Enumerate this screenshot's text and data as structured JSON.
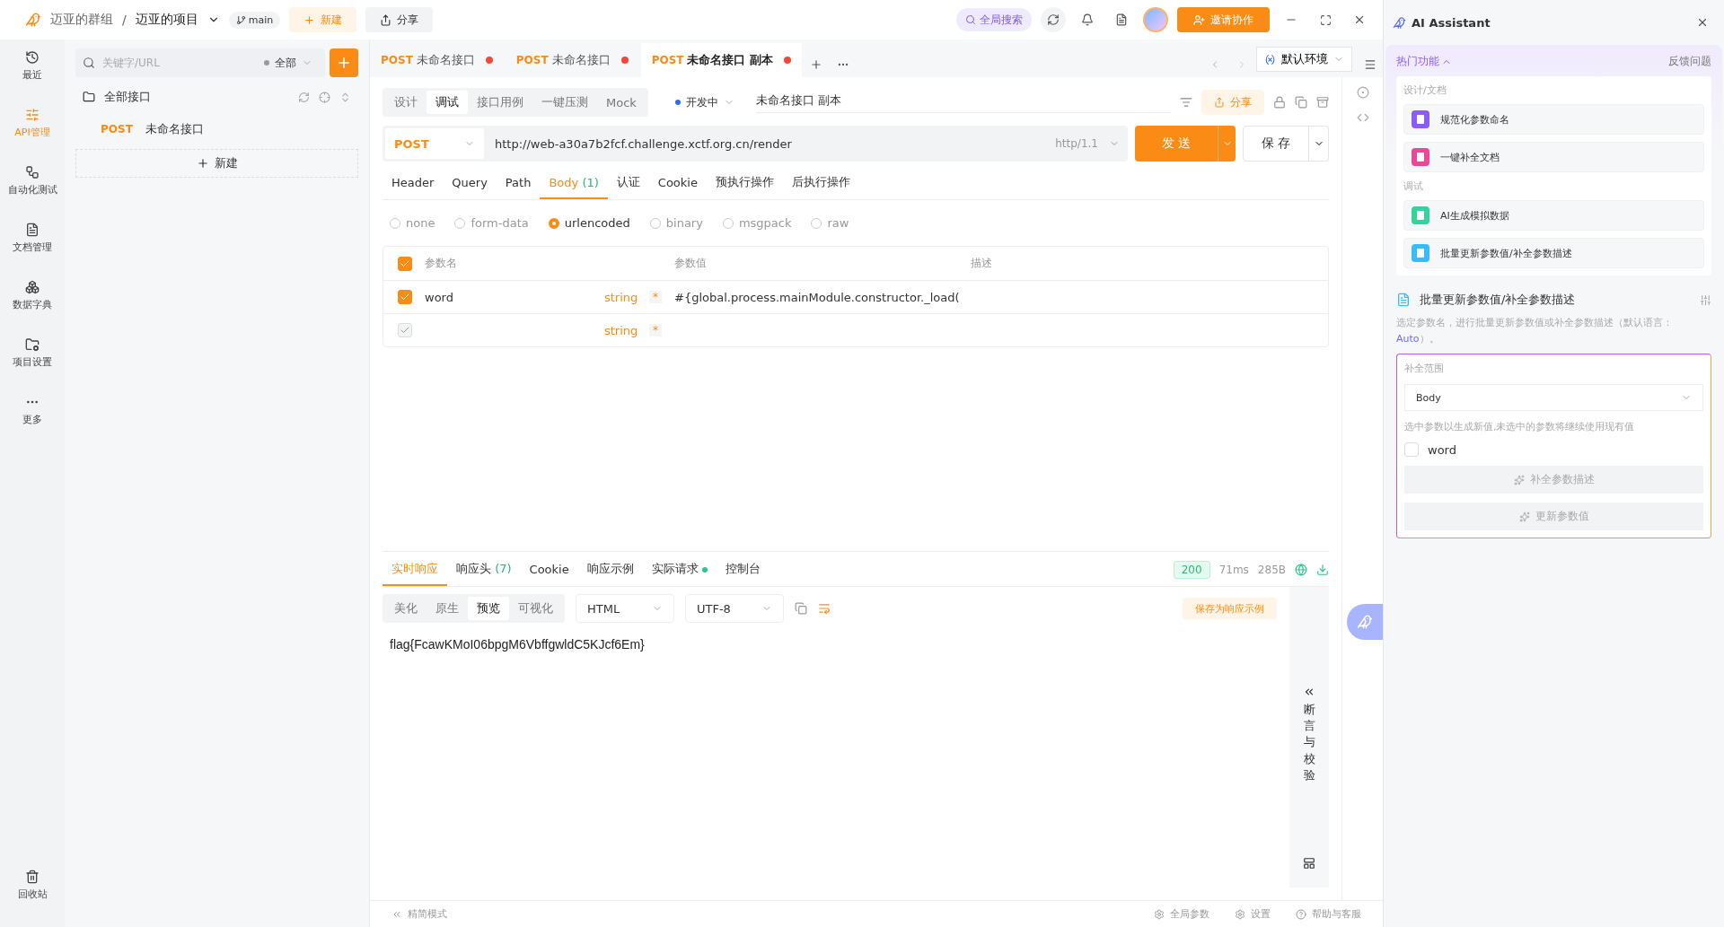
{
  "breadcrumb": {
    "team": "迈亚的群组",
    "separator": "/",
    "project": "迈亚的项目",
    "branch": "main"
  },
  "top_actions": [
    {
      "label": "新建",
      "kind": "new"
    },
    {
      "label": "分享",
      "kind": "share"
    }
  ],
  "global_search": "全局搜索",
  "invite": "邀请协作",
  "nav": [
    {
      "label": "最近",
      "selected": false
    },
    {
      "label": "API管理",
      "selected": true
    },
    {
      "label": "自动化测试",
      "selected": false
    },
    {
      "label": "文档管理",
      "selected": false
    },
    {
      "label": "数据字典",
      "selected": false
    },
    {
      "label": "项目设置",
      "selected": false
    },
    {
      "label": "更多",
      "selected": false
    }
  ],
  "trash": "回收站",
  "tree": {
    "placeholder": "关键字/URL",
    "filter": "全部",
    "root": "全部接口",
    "items": [
      {
        "method": "POST",
        "name": "未命名接口"
      }
    ],
    "new_label": "新建"
  },
  "tabs": [
    {
      "method": "POST",
      "name": "未命名接口",
      "selected": false,
      "unsaved": true
    },
    {
      "method": "POST",
      "name": "未命名接口",
      "selected": false,
      "unsaved": true
    },
    {
      "method": "POST",
      "name": "未命名接口 副本",
      "selected": true,
      "unsaved": true
    }
  ],
  "environment": "默认环境",
  "mode_tabs": [
    {
      "label": "设计",
      "selected": false
    },
    {
      "label": "调试",
      "selected": true
    },
    {
      "label": "接口用例",
      "selected": false
    },
    {
      "label": "一键压测",
      "selected": false
    },
    {
      "label": "Mock",
      "selected": false
    }
  ],
  "status": "开发中",
  "api_name": "未命名接口 副本",
  "share": "分享",
  "request": {
    "method": "POST",
    "url": "http://web-a30a7b2fcf.challenge.xctf.org.cn/render",
    "protocol": "http/1.1",
    "send": "发 送",
    "save": "保 存"
  },
  "param_tabs": [
    {
      "label": "Header",
      "selected": false
    },
    {
      "label": "Query",
      "selected": false
    },
    {
      "label": "Path",
      "selected": false
    },
    {
      "label": "Body",
      "count": "(1)",
      "selected": true
    },
    {
      "label": "认证",
      "selected": false
    },
    {
      "label": "Cookie",
      "selected": false
    },
    {
      "label": "预执行操作",
      "selected": false
    },
    {
      "label": "后执行操作",
      "selected": false
    }
  ],
  "body_types": [
    {
      "label": "none",
      "selected": false
    },
    {
      "label": "form-data",
      "selected": false
    },
    {
      "label": "urlencoded",
      "selected": true
    },
    {
      "label": "binary",
      "selected": false
    },
    {
      "label": "msgpack",
      "selected": false
    },
    {
      "label": "raw",
      "selected": false
    }
  ],
  "params": {
    "columns": [
      "参数名",
      "参数值",
      "描述"
    ],
    "all_checked": true,
    "rows": [
      {
        "checked": true,
        "disabled": false,
        "name": "word",
        "type": "string",
        "required": "*",
        "value": "#{global.process.mainModule.constructor._load("
      },
      {
        "checked": true,
        "disabled": true,
        "type": "string",
        "required": "*"
      }
    ]
  },
  "response_tabs": [
    {
      "label": "实时响应",
      "selected": true
    },
    {
      "label": "响应头",
      "count": "(7)",
      "selected": false
    },
    {
      "label": "Cookie",
      "selected": false
    },
    {
      "label": "响应示例",
      "selected": false
    },
    {
      "label": "实际请求",
      "dot": true,
      "selected": false
    },
    {
      "label": "控制台",
      "selected": false
    }
  ],
  "response_meta": {
    "status": "200",
    "time": "71ms",
    "size": "285B"
  },
  "view_tabs": [
    {
      "label": "美化",
      "selected": false
    },
    {
      "label": "原生",
      "selected": false
    },
    {
      "label": "预览",
      "selected": true
    },
    {
      "label": "可视化",
      "selected": false
    }
  ],
  "format": "HTML",
  "encoding": "UTF-8",
  "save_example": "保存为响应示例",
  "response_body": "flag{FcawKMoI06bpgM6VbffgwldC5KJcf6Em}",
  "assertions": "断言与校验",
  "footer": {
    "simple_mode": "精简模式",
    "links": [
      "全局参数",
      "设置",
      "帮助与客服"
    ]
  },
  "ai": {
    "title": "AI Assistant",
    "hot": "热门功能",
    "feedback": "反馈问题",
    "groups": [
      {
        "title": "设计/文档",
        "items": [
          {
            "label": "规范化参数命名",
            "color": "#8b5cf6"
          },
          {
            "label": "一键补全文档",
            "color": "#ec4899"
          }
        ]
      },
      {
        "title": "调试",
        "items": [
          {
            "label": "AI生成模拟数据",
            "color": "#34d399"
          },
          {
            "label": "批量更新参数值/补全参数描述",
            "color": "#38bdf8"
          }
        ]
      }
    ],
    "tool": {
      "title": "批量更新参数值/补全参数描述",
      "description": "选定参数名，进行批量更新参数值或补全参数描述（默认语言：",
      "language": "Auto",
      "description_end": "）。",
      "scope_label": "补全范围",
      "scope": "Body",
      "hint": "选中参数以生成新值,未选中的参数将继续使用现有值",
      "params": [
        {
          "name": "word",
          "checked": false
        }
      ],
      "buttons": [
        "补全参数描述",
        "更新参数值"
      ]
    }
  }
}
